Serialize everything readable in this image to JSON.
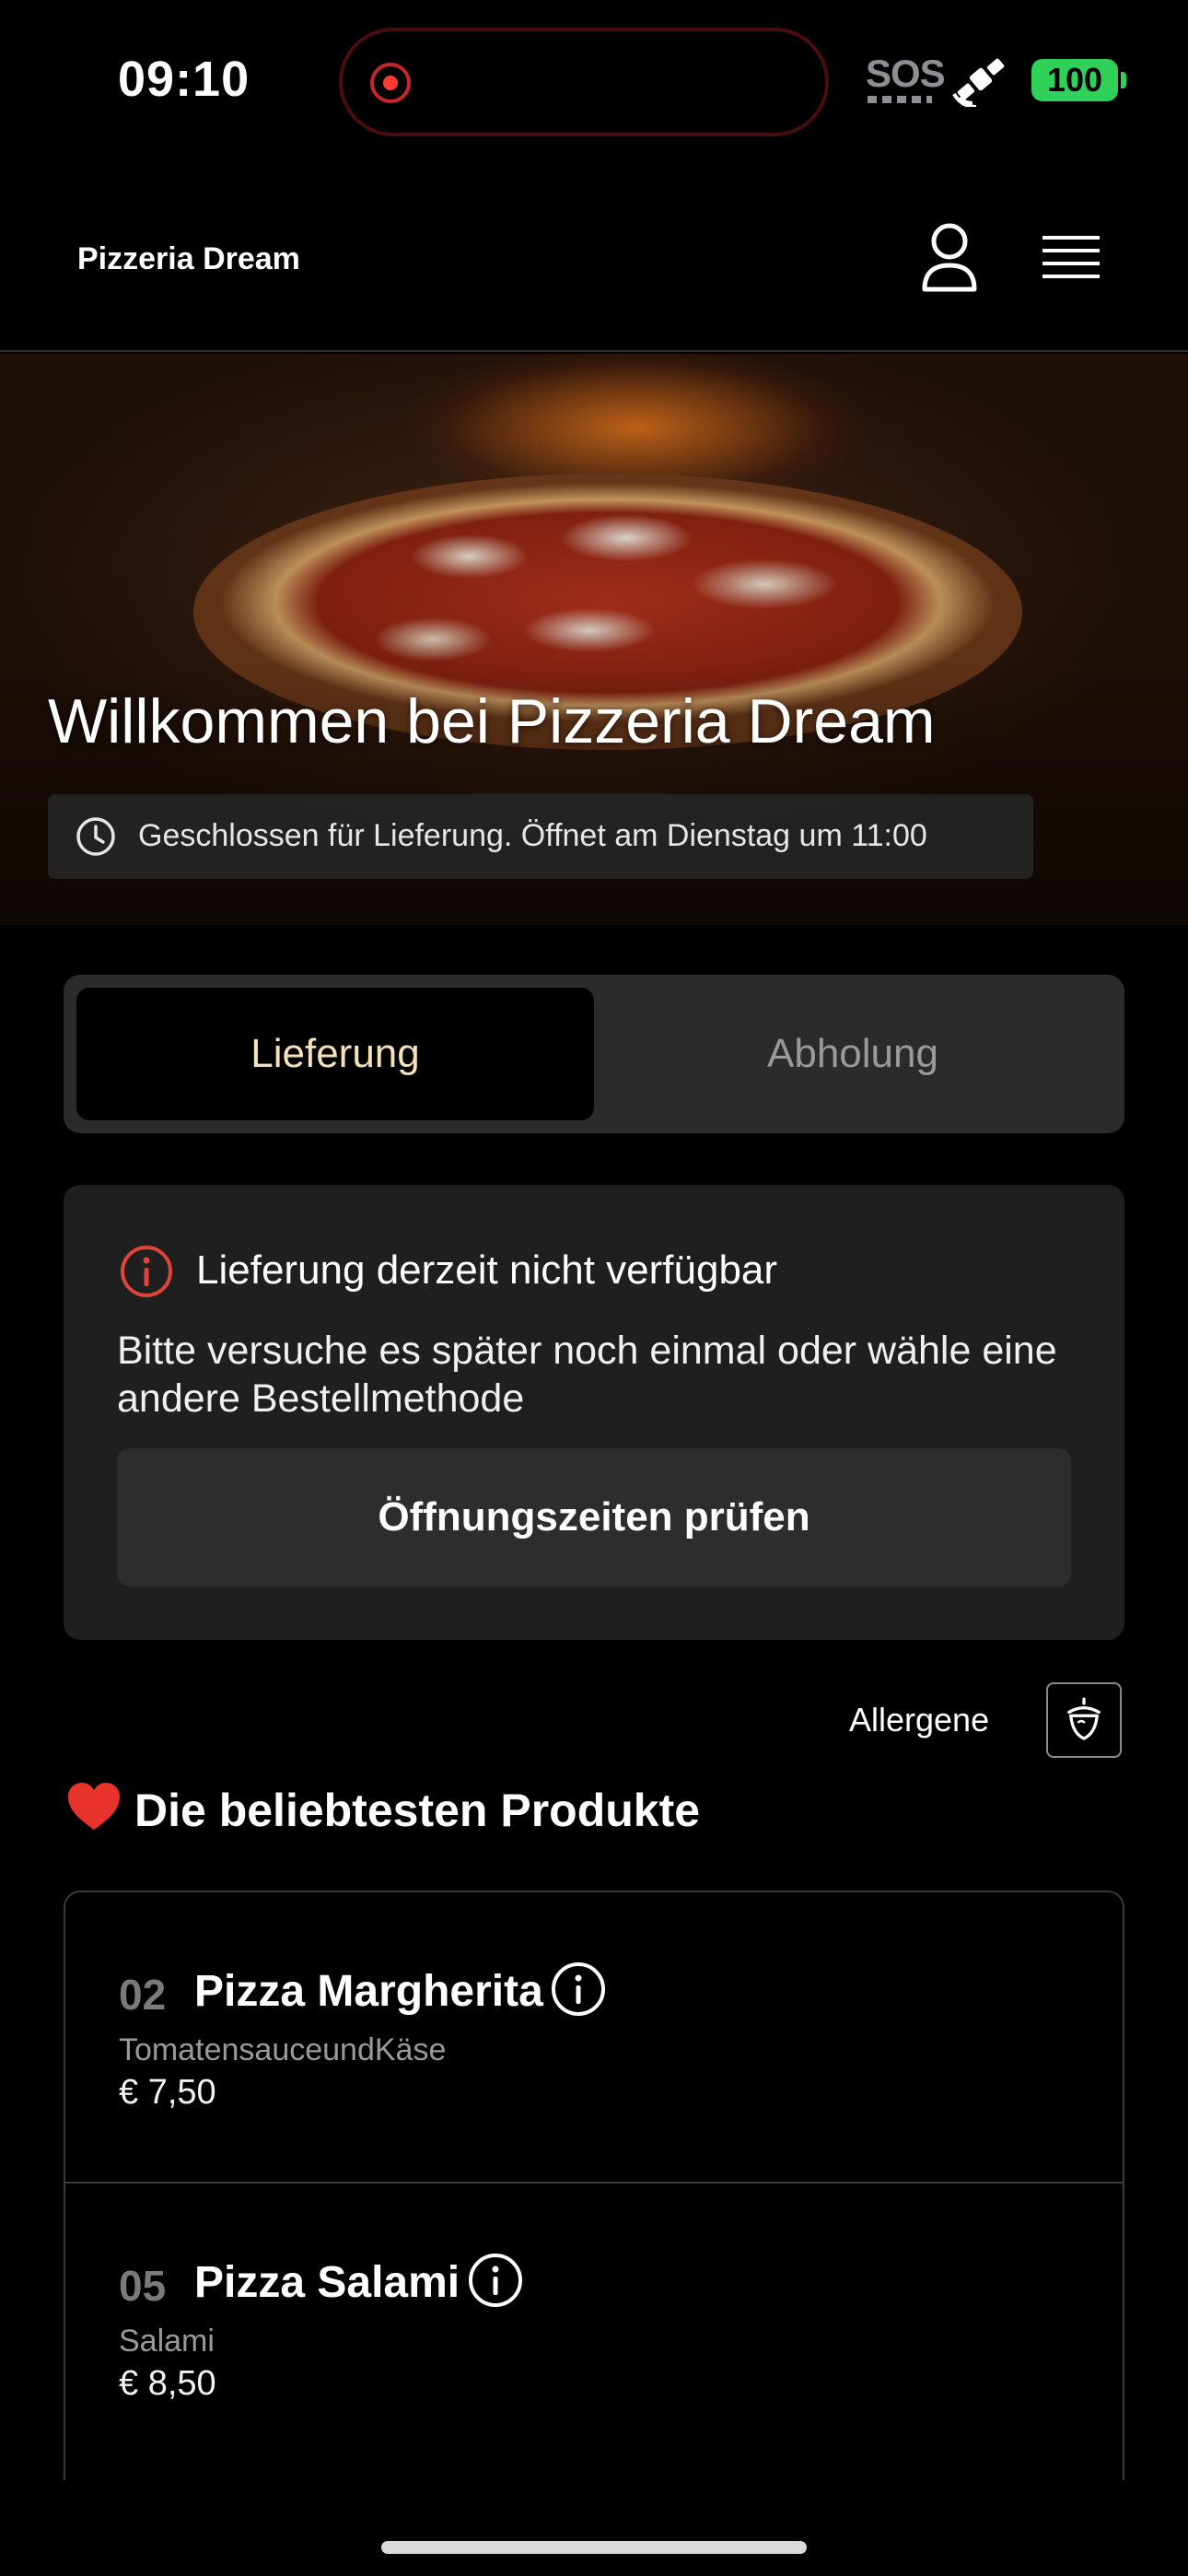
{
  "status_bar": {
    "time": "09:10",
    "sos": "SOS",
    "battery": "100",
    "icons": [
      "recording-icon",
      "satellite-icon",
      "battery-icon"
    ],
    "battery_color": "#30d158",
    "recording_color": "#ff3b30"
  },
  "header": {
    "brand": "Pizzeria Dream",
    "icons": [
      "user-icon",
      "menu-icon"
    ]
  },
  "hero": {
    "title": "Willkommen bei Pizzeria Dream",
    "status": "Geschlossen für Lieferung. Öffnet am Dienstag um 11:00",
    "icon": "clock-icon"
  },
  "order_method": {
    "options": [
      {
        "label": "Lieferung",
        "selected": true
      },
      {
        "label": "Abholung",
        "selected": false
      }
    ],
    "active_color": "#f5e2b8"
  },
  "alert": {
    "icon": "info-circle-icon",
    "title": "Lieferung derzeit nicht verfügbar",
    "message": "Bitte versuche es später noch einmal oder wähle eine andere Bestellmethode",
    "button_label": "Öffnungszeiten prüfen",
    "icon_color": "#e0453a"
  },
  "allergens": {
    "label": "Allergene",
    "icon": "acorn-icon"
  },
  "popular": {
    "title": "Die beliebtesten Produkte",
    "icon": "heart-icon",
    "products": [
      {
        "number": "02",
        "name": "Pizza Margherita",
        "description": "TomatensauceundKäse",
        "price": "€ 7,50"
      },
      {
        "number": "05",
        "name": "Pizza Salami",
        "description": "Salami",
        "price": "€ 8,50"
      }
    ]
  }
}
